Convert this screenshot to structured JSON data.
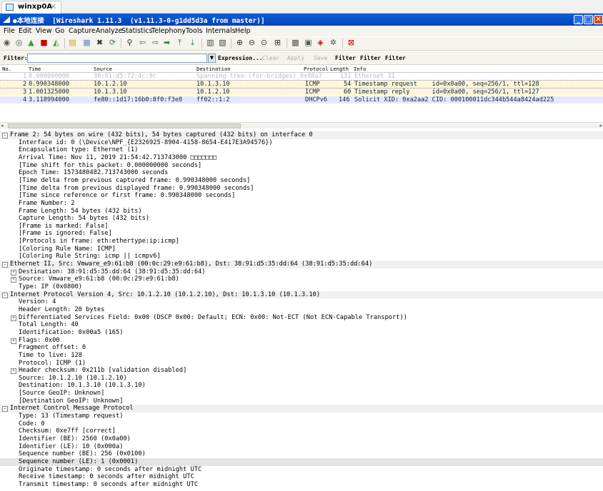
{
  "host_tab": {
    "label": "winxp0A",
    "close": "✕"
  },
  "window": {
    "title": "●本地连接  [Wireshark 1.11.3  (v1.11.3-0-g1dd5d3a from master)]"
  },
  "menu": [
    "File",
    "Edit",
    "View",
    "Go",
    "Capture",
    "Analyze",
    "Statistics",
    "Telephony",
    "Tools",
    "Internals",
    "Help"
  ],
  "filter": {
    "label": "Filter:",
    "value": "",
    "expression": "Expression...",
    "clear": "Clear",
    "apply": "Apply",
    "save": "Save",
    "f1": "Filter",
    "f2": "Filter",
    "f3": "Filter"
  },
  "packet_list": {
    "columns": [
      "No.",
      "Time",
      "Source",
      "Destination",
      "Protocol",
      "Length",
      "Info"
    ],
    "rows": [
      {
        "no": "1",
        "time": "0.000000000",
        "src": "38:91:d5:72:4c:9c",
        "dst": "Spanning-tree-(for-bridges)_0x88a7",
        "proto": "",
        "len": "131",
        "info": "Ethernet II"
      },
      {
        "no": "2",
        "time": "0.990348000",
        "src": "10.1.2.10",
        "dst": "10.1.3.10",
        "proto": "ICMP",
        "len": "54",
        "info": "Timestamp request    id=0x0a00, seq=256/1, ttl=128"
      },
      {
        "no": "3",
        "time": "1.001325000",
        "src": "10.1.3.10",
        "dst": "10.1.2.10",
        "proto": "ICMP",
        "len": "60",
        "info": "Timestamp reply      id=0x0a00, seq=256/1, ttl=127"
      },
      {
        "no": "4",
        "time": "3.118994000",
        "src": "fe80::1d17:16b0:8f0:f3e8",
        "dst": "ff02::1:2",
        "proto": "DHCPv6",
        "len": "146",
        "info": "Solicit XID: 0xa2aa2 CID: 000100011dc344b544a8424ad225"
      }
    ]
  },
  "details": [
    {
      "t": "Frame 2: 54 bytes on wire (432 bits), 54 bytes captured (432 bits) on interface 0",
      "tog": "minus",
      "hdr": true
    },
    {
      "t": "Interface id: 0 (\\Device\\NPF_{E2326925-8904-4158-8654-E417E3A94576})",
      "indent": 1
    },
    {
      "t": "Encapsulation type: Ethernet (1)",
      "indent": 1
    },
    {
      "t": "Arrival Time: Nov 11, 2019 21:54:42.713743000 □□□□□□□",
      "indent": 1
    },
    {
      "t": "[Time shift for this packet: 0.000000000 seconds]",
      "indent": 1
    },
    {
      "t": "Epoch Time: 1573480482.713743000 seconds",
      "indent": 1
    },
    {
      "t": "[Time delta from previous captured frame: 0.990348000 seconds]",
      "indent": 1
    },
    {
      "t": "[Time delta from previous displayed frame: 0.990348000 seconds]",
      "indent": 1
    },
    {
      "t": "[Time since reference or first frame: 0.990348000 seconds]",
      "indent": 1
    },
    {
      "t": "Frame Number: 2",
      "indent": 1
    },
    {
      "t": "Frame Length: 54 bytes (432 bits)",
      "indent": 1
    },
    {
      "t": "Capture Length: 54 bytes (432 bits)",
      "indent": 1
    },
    {
      "t": "[Frame is marked: False]",
      "indent": 1
    },
    {
      "t": "[Frame is ignored: False]",
      "indent": 1
    },
    {
      "t": "[Protocols in frame: eth:ethertype:ip:icmp]",
      "indent": 1
    },
    {
      "t": "[Coloring Rule Name: ICMP]",
      "indent": 1
    },
    {
      "t": "[Coloring Rule String: icmp || icmpv6]",
      "indent": 1
    },
    {
      "t": "Ethernet II, Src: Vmware_e9:61:b8 (00:0c:29:e9:61:b8), Dst: 38:91:d5:35:dd:64 (38:91:d5:35:dd:64)",
      "tog": "minus",
      "hdr": true
    },
    {
      "t": "Destination: 38:91:d5:35:dd:64 (38:91:d5:35:dd:64)",
      "indent": 1,
      "tog": "plus"
    },
    {
      "t": "Source: Vmware_e9:61:b8 (00:0c:29:e9:61:b8)",
      "indent": 1,
      "tog": "plus"
    },
    {
      "t": "Type: IP (0x0800)",
      "indent": 1
    },
    {
      "t": "Internet Protocol Version 4, Src: 10.1.2.10 (10.1.2.10), Dst: 10.1.3.10 (10.1.3.10)",
      "tog": "minus",
      "hdr": true
    },
    {
      "t": "Version: 4",
      "indent": 1
    },
    {
      "t": "Header Length: 20 bytes",
      "indent": 1
    },
    {
      "t": "Differentiated Services Field: 0x00 (DSCP 0x00: Default; ECN: 0x00: Not-ECT (Not ECN-Capable Transport))",
      "indent": 1,
      "tog": "plus"
    },
    {
      "t": "Total Length: 40",
      "indent": 1
    },
    {
      "t": "Identification: 0x00a5 (165)",
      "indent": 1
    },
    {
      "t": "Flags: 0x00",
      "indent": 1,
      "tog": "plus"
    },
    {
      "t": "Fragment offset: 0",
      "indent": 1
    },
    {
      "t": "Time to live: 128",
      "indent": 1
    },
    {
      "t": "Protocol: ICMP (1)",
      "indent": 1
    },
    {
      "t": "Header checksum: 0x211b [validation disabled]",
      "indent": 1,
      "tog": "plus"
    },
    {
      "t": "Source: 10.1.2.10 (10.1.2.10)",
      "indent": 1
    },
    {
      "t": "Destination: 10.1.3.10 (10.1.3.10)",
      "indent": 1
    },
    {
      "t": "[Source GeoIP: Unknown]",
      "indent": 1
    },
    {
      "t": "[Destination GeoIP: Unknown]",
      "indent": 1
    },
    {
      "t": "Internet Control Message Protocol",
      "tog": "minus",
      "hdr": true
    },
    {
      "t": "Type: 13 (Timestamp request)",
      "indent": 1
    },
    {
      "t": "Code: 0",
      "indent": 1
    },
    {
      "t": "Checksum: 0xe7ff [correct]",
      "indent": 1
    },
    {
      "t": "Identifier (BE): 2560 (0x0a00)",
      "indent": 1
    },
    {
      "t": "Identifier (LE): 10 (0x000a)",
      "indent": 1
    },
    {
      "t": "Sequence number (BE): 256 (0x0100)",
      "indent": 1
    },
    {
      "t": "Sequence number (LE): 1 (0x0001)",
      "indent": 1,
      "sel": true
    },
    {
      "t": "Originate timestamp: 0 seconds after midnight UTC",
      "indent": 1
    },
    {
      "t": "Receive timestamp: 0 seconds after midnight UTC",
      "indent": 1
    },
    {
      "t": "Transmit timestamp: 0 seconds after midnight UTC",
      "indent": 1
    }
  ]
}
